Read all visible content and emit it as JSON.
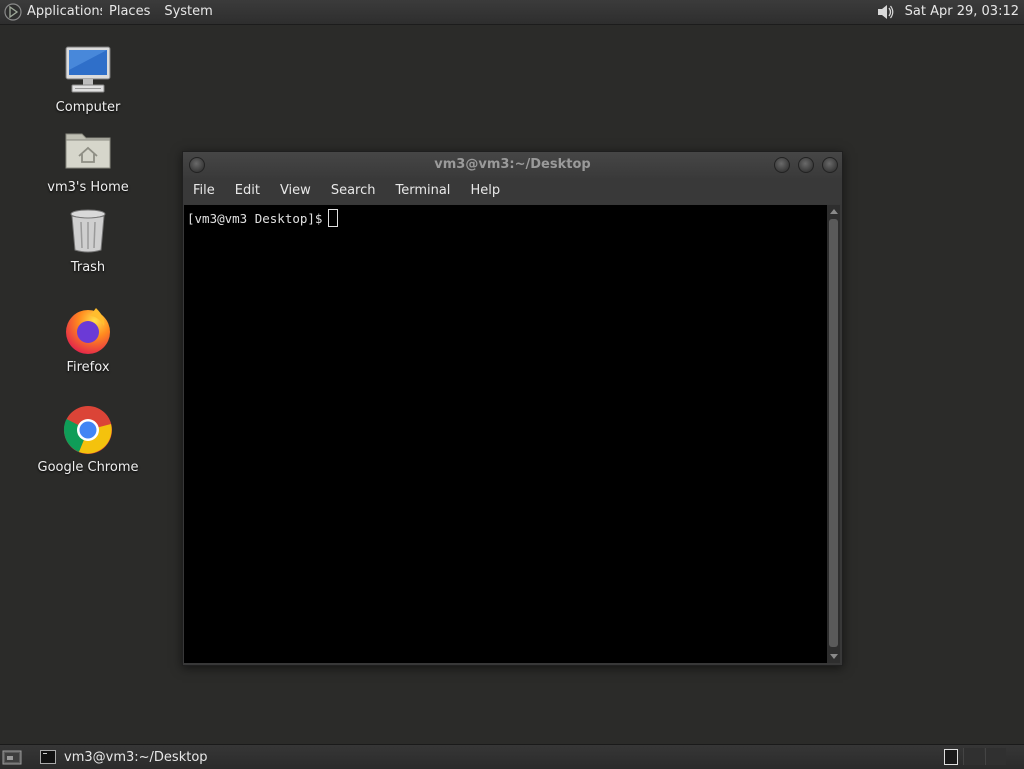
{
  "top_panel": {
    "menus": [
      "Applications",
      "Places",
      "System"
    ],
    "clock": "Sat Apr 29, 03:12",
    "icons": {
      "logo": "app-menu-logo-icon",
      "volume": "volume-icon"
    }
  },
  "desktop": {
    "icons": [
      {
        "label": "Computer",
        "icon": "computer-icon"
      },
      {
        "label": "vm3's Home",
        "icon": "home-folder-icon"
      },
      {
        "label": "Trash",
        "icon": "trash-icon"
      },
      {
        "label": "Firefox",
        "icon": "firefox-icon"
      },
      {
        "label": "Google Chrome",
        "icon": "chrome-icon"
      }
    ]
  },
  "terminal": {
    "title": "vm3@vm3:~/Desktop",
    "menu": [
      "File",
      "Edit",
      "View",
      "Search",
      "Terminal",
      "Help"
    ],
    "prompt": "[vm3@vm3 Desktop]$"
  },
  "bottom_panel": {
    "task_label": "vm3@vm3:~/Desktop"
  }
}
